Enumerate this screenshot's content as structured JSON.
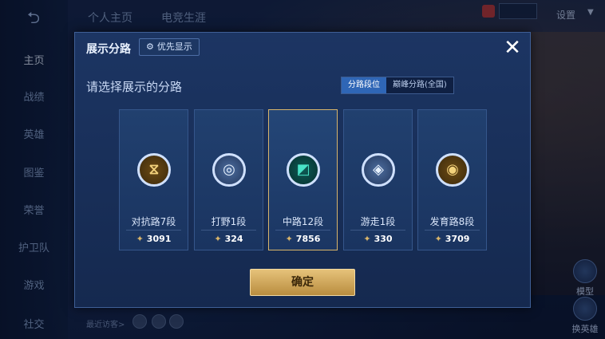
{
  "background": {
    "top_tabs": [
      "个人主页",
      "电竞生涯"
    ],
    "sidebar_items": [
      "主页",
      "战绩",
      "英雄",
      "图鉴",
      "荣誉",
      "护卫队",
      "游戏",
      "社交"
    ],
    "settings_label": "设置",
    "recent_visitors": "最近访客>",
    "right_buttons": [
      "模型",
      "换英雄"
    ]
  },
  "modal": {
    "title": "展示分路",
    "priority_label": "优先显示",
    "close_label": "✕",
    "subtitle": "请选择展示的分路",
    "segments": [
      {
        "label": "分路段位",
        "active": true
      },
      {
        "label": "巅峰分路(全国)",
        "active": false
      }
    ],
    "lanes": [
      {
        "name": "对抗路7段",
        "score": "3091",
        "glyph": "⧖",
        "style": "gold",
        "selected": false
      },
      {
        "name": "打野1段",
        "score": "324",
        "glyph": "◎",
        "style": "silver",
        "selected": false
      },
      {
        "name": "中路12段",
        "score": "7856",
        "glyph": "◩",
        "style": "green",
        "selected": true
      },
      {
        "name": "游走1段",
        "score": "330",
        "glyph": "◈",
        "style": "silver",
        "selected": false
      },
      {
        "name": "发育路8段",
        "score": "3709",
        "glyph": "◉",
        "style": "gold",
        "selected": false
      }
    ],
    "confirm_label": "确定"
  },
  "colors": {
    "accent_gold": "#d9b56b",
    "segment_active": "#2f66b6",
    "modal_bg": "#1c3563"
  }
}
